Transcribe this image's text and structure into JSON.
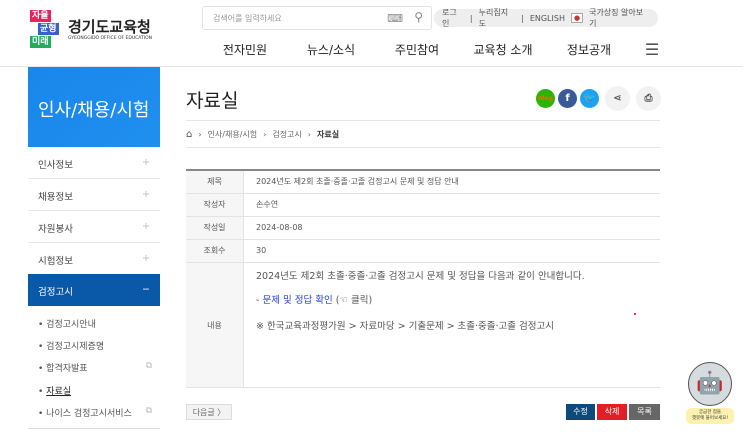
{
  "header": {
    "logo_tags": [
      "자율",
      "균형",
      "미래"
    ],
    "logo_name": "경기도교육청",
    "logo_sub": "GYEONGGIDO OFFICE OF EDUCATION",
    "search_placeholder": "검색어를 입력하세요",
    "util": [
      "로그인",
      "누리집지도",
      "ENGLISH",
      "국가상징 알아보기"
    ],
    "gnb": [
      "전자민원",
      "뉴스/소식",
      "주민참여",
      "교육청 소개",
      "정보공개"
    ]
  },
  "sidebar": {
    "title": "인사/채용/시험",
    "menu": [
      "인사정보",
      "채용정보",
      "자원봉사",
      "시험정보",
      "검정고시"
    ],
    "sub": [
      "검정고시안내",
      "검정고시제증명",
      "합격자발표",
      "자료실",
      "나이스 검정고시서비스"
    ]
  },
  "page": {
    "title": "자료실",
    "breadcrumb": [
      "인사/채용/시험",
      "검정고시",
      "자료실"
    ]
  },
  "post": {
    "labels": [
      "제목",
      "작성자",
      "작성일",
      "조회수",
      "내용"
    ],
    "subject": "2024년도 제2회 초졸·중졸·고졸 검정고시 문제 및 정답 안내",
    "author": "손수연",
    "date": "2024-08-08",
    "views": "30",
    "body_line1": "2024년도 제2회 초졸·중졸·고졸 검정고시 문제 및 정답을 다음과 같이 안내합니다.",
    "body_dash": "- ",
    "body_link": "문제 및 정답 확인",
    "body_click": " (☜ 클릭)",
    "body_line3": "※ 한국교육과정평가원 > 자료마당 > 기출문제 > 초졸·중졸·고졸 검정고시"
  },
  "buttons": {
    "next": "다음글 〉",
    "edit": "수정",
    "delete": "삭제",
    "list": "목록"
  },
  "social": {
    "blog": "blog",
    "facebook": "f"
  },
  "chatbot": {
    "line1": "궁금한 점을",
    "line2": "챗봇에 물어보세요!"
  }
}
